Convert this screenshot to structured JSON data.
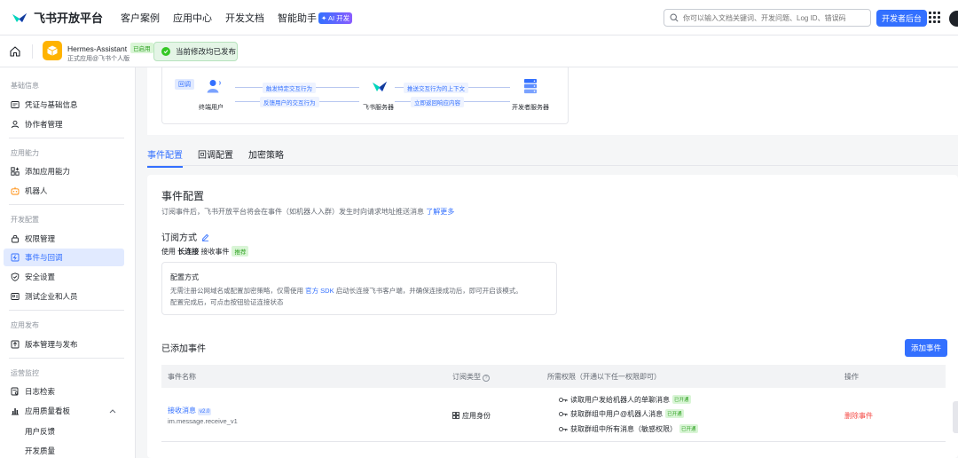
{
  "topnav": {
    "logo_text": "飞书开放平台",
    "links": [
      "客户案例",
      "应用中心",
      "开发文档",
      "智能助手"
    ],
    "ai_badge": "✦ AI 开发",
    "search_placeholder": "你可以输入文档关键词、开发问题、Log ID、错误码",
    "dev_console": "开发者后台"
  },
  "appbar": {
    "app_name": "Hermes-Assistant",
    "app_state": "已启用",
    "app_sub": "正式应用@飞书个人版",
    "publish_banner": "当前修改均已发布"
  },
  "sidebar": {
    "groups": {
      "basic": "基础信息",
      "ability": "应用能力",
      "dev": "开发配置",
      "release": "应用发布",
      "ops": "运营监控"
    },
    "items": {
      "credentials": "凭证与基础信息",
      "collaborators": "协作者管理",
      "add_ability": "添加应用能力",
      "bot": "机器人",
      "permissions": "权限管理",
      "events": "事件与回调",
      "security": "安全设置",
      "test_org": "测试企业和人员",
      "versions": "版本管理与发布",
      "logs": "日志检索",
      "quality": "应用质量看板",
      "feedback": "用户反馈",
      "dev_quality": "开发质量"
    }
  },
  "flow": {
    "tag": "回调",
    "end_user": "终端用户",
    "server": "飞书服务器",
    "dev_server": "开发者服务器",
    "arrow1": "触发特定交互行为",
    "arrow2": "反馈用户的交互行为",
    "arrow3": "推送交互行为的上下文",
    "arrow4": "立即返回响应内容"
  },
  "tabs": [
    "事件配置",
    "回调配置",
    "加密策略"
  ],
  "event_config": {
    "title": "事件配置",
    "desc": "订阅事件后，飞书开放平台将会在事件（如机器人入群）发生时向请求地址推送消息",
    "learn_more": "了解更多",
    "sub_method_title": "订阅方式",
    "sub_method_prefix": "使用",
    "sub_method_bold": "长连接",
    "sub_method_suffix": "接收事件",
    "recommended": "推荐",
    "config_title": "配置方式",
    "config_line1_a": "无需注册公网域名或配置加密策略，仅需使用",
    "config_line1_link": "官方 SDK",
    "config_line1_b": "启动长连接飞书客户端，并确保连接成功后，即可开启该模式。",
    "config_line2": "配置完成后，可点击按钮验证连接状态"
  },
  "events": {
    "title": "已添加事件",
    "add_button": "添加事件",
    "columns": {
      "name": "事件名称",
      "type": "订阅类型",
      "perms": "所需权限（开通以下任一权限即可）",
      "ops": "操作"
    },
    "rows": [
      {
        "name": "接收消息",
        "version": "v2.0",
        "key": "im.message.receive_v1",
        "type": "应用身份",
        "perms": [
          {
            "label": "读取用户发给机器人的单聊消息",
            "status": "已开通"
          },
          {
            "label": "获取群组中用户@机器人消息",
            "status": "已开通"
          },
          {
            "label": "获取群组中所有消息（敏感权限）",
            "status": "已开通"
          }
        ],
        "delete": "删除事件"
      }
    ]
  },
  "colors": {
    "brand": "#3370ff",
    "success": "#2ea121",
    "danger": "#f54a45"
  }
}
